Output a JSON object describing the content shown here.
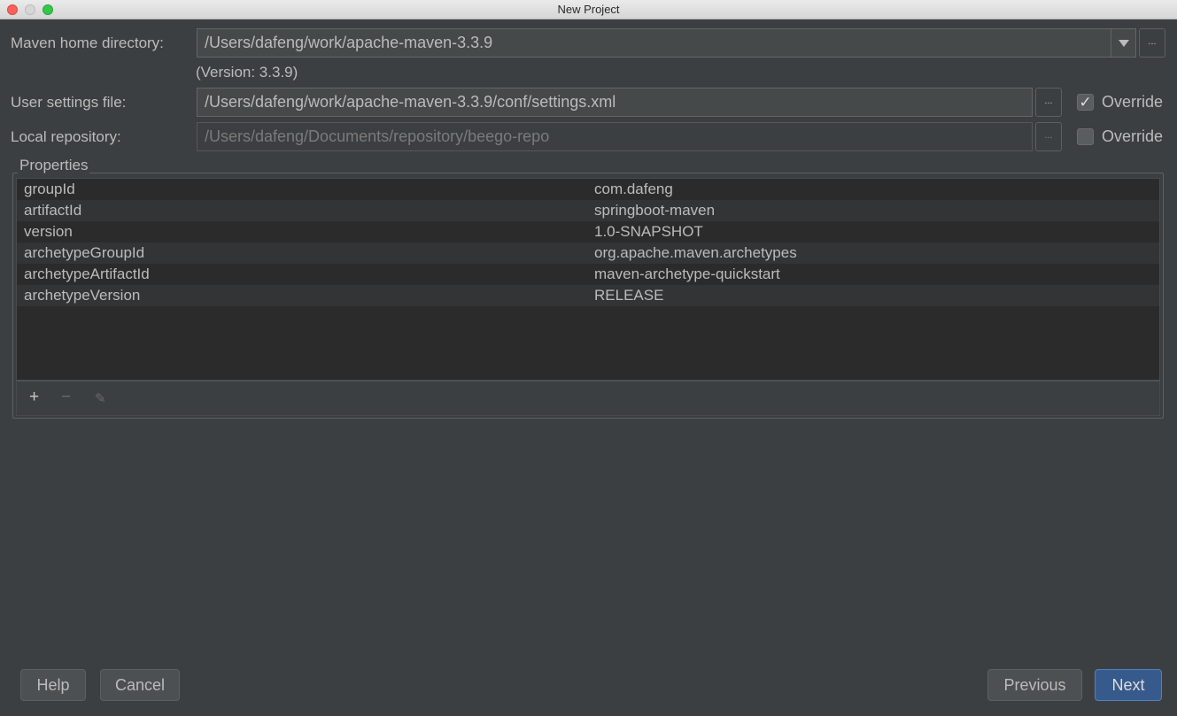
{
  "window": {
    "title": "New Project"
  },
  "form": {
    "maven_home": {
      "label": "Maven home directory:",
      "value": "/Users/dafeng/work/apache-maven-3.3.9",
      "version_note": "(Version: 3.3.9)"
    },
    "user_settings": {
      "label": "User settings file:",
      "value": "/Users/dafeng/work/apache-maven-3.3.9/conf/settings.xml",
      "override_label": "Override",
      "override_checked": true
    },
    "local_repository": {
      "label": "Local repository:",
      "value": "/Users/dafeng/Documents/repository/beego-repo",
      "override_label": "Override",
      "override_checked": false
    },
    "browse_label": "..."
  },
  "properties": {
    "title": "Properties",
    "rows": [
      {
        "key": "groupId",
        "value": "com.dafeng"
      },
      {
        "key": "artifactId",
        "value": "springboot-maven"
      },
      {
        "key": "version",
        "value": "1.0-SNAPSHOT"
      },
      {
        "key": "archetypeGroupId",
        "value": "org.apache.maven.archetypes"
      },
      {
        "key": "archetypeArtifactId",
        "value": "maven-archetype-quickstart"
      },
      {
        "key": "archetypeVersion",
        "value": "RELEASE"
      }
    ],
    "toolbar": {
      "add": "+",
      "remove": "−",
      "edit": "✎"
    }
  },
  "buttons": {
    "help": "Help",
    "cancel": "Cancel",
    "previous": "Previous",
    "next": "Next"
  },
  "colors": {
    "background": "#3c3f41",
    "field": "#45494a",
    "table": "#2b2b2b",
    "primary_button": "#375a8c"
  }
}
